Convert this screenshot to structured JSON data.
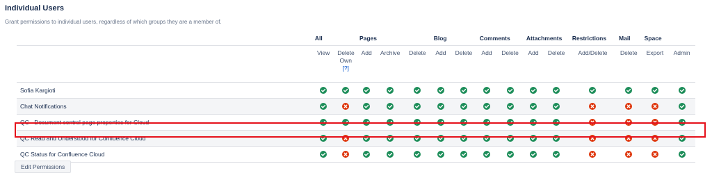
{
  "section": {
    "title": "Individual Users",
    "description": "Grant permissions to individual users, regardless of which groups they are a member of."
  },
  "groups": [
    "All",
    "Pages",
    "Blog",
    "Comments",
    "Attachments",
    "Restrictions",
    "Mail",
    "Space"
  ],
  "columns": {
    "view": "View",
    "delete_own": "Delete Own",
    "help_link": "[?]",
    "pages_add": "Add",
    "pages_archive": "Archive",
    "pages_delete": "Delete",
    "blog_add": "Add",
    "blog_delete": "Delete",
    "comments_add": "Add",
    "comments_delete": "Delete",
    "attachments_add": "Add",
    "attachments_delete": "Delete",
    "restrictions_add_delete": "Add/Delete",
    "mail_delete": "Delete",
    "space_export": "Export",
    "space_admin": "Admin"
  },
  "rows": [
    {
      "name": "Sofia Kargioti",
      "perms": [
        true,
        true,
        true,
        true,
        true,
        true,
        true,
        true,
        true,
        true,
        true,
        true,
        true,
        true,
        true
      ]
    },
    {
      "name": "Chat Notifications",
      "perms": [
        true,
        false,
        true,
        true,
        true,
        true,
        true,
        true,
        true,
        true,
        true,
        false,
        false,
        false,
        true
      ]
    },
    {
      "name": "QC - Document control page properties for Cloud",
      "perms": [
        true,
        true,
        true,
        true,
        true,
        true,
        true,
        true,
        true,
        true,
        true,
        false,
        false,
        false,
        true
      ]
    },
    {
      "name": "QC Read and Understood for Confluence Cloud",
      "perms": [
        true,
        false,
        true,
        true,
        true,
        true,
        true,
        true,
        true,
        true,
        true,
        false,
        false,
        false,
        true
      ]
    },
    {
      "name": "QC Status for Confluence Cloud",
      "perms": [
        true,
        false,
        true,
        true,
        true,
        true,
        true,
        true,
        true,
        true,
        true,
        false,
        false,
        false,
        true
      ]
    }
  ],
  "icons": {
    "granted": "check-circle-icon",
    "denied": "cross-circle-icon"
  },
  "colors": {
    "granted": "#1e8e5a",
    "denied": "#de350b",
    "highlight": "#e5111b"
  },
  "edit_button_label": "Edit Permissions"
}
